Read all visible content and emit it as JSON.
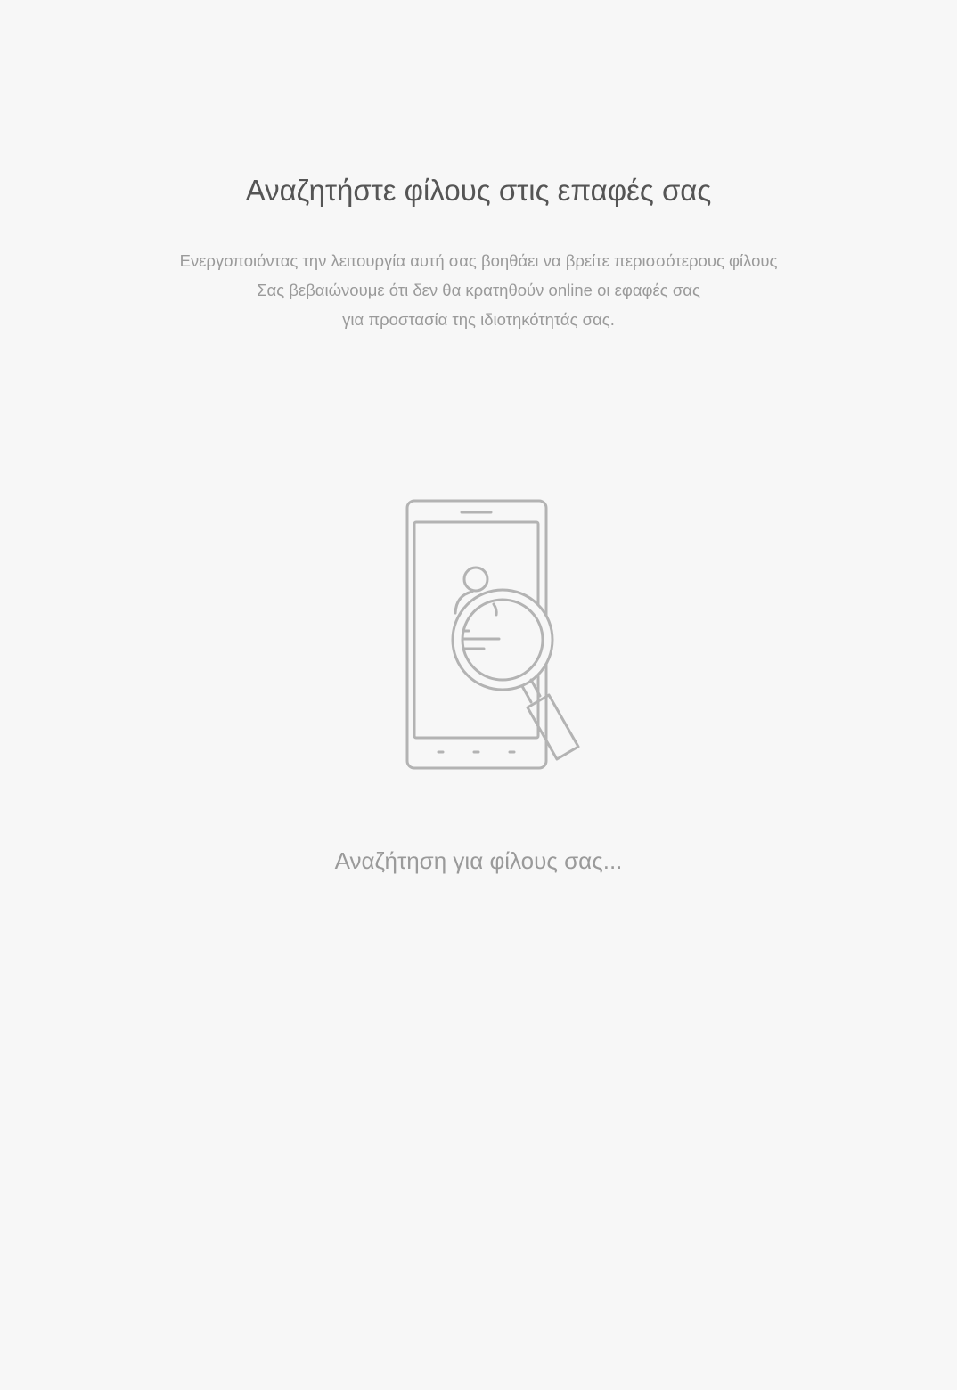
{
  "header": {
    "title": "Αναζητήστε φίλους στις επαφές σας"
  },
  "description": {
    "lines": [
      "Ενεργοποιόντας την λειτουργία αυτή σας βοηθάει να βρείτε περισσότερους φίλους",
      "Σας βεβαιώνουμε ότι δεν θα κρατηθούν online οι εφαφές σας",
      "για προστασία της ιδιοτηκότητάς σας."
    ]
  },
  "illustration": {
    "icon": "phone-search-contacts-icon",
    "stroke_color": "#b3b3b3"
  },
  "status": {
    "text": "Αναζήτηση για φίλους σας..."
  },
  "colors": {
    "background": "#f7f7f7",
    "title": "#555555",
    "secondary_text": "#9a9a9a"
  }
}
